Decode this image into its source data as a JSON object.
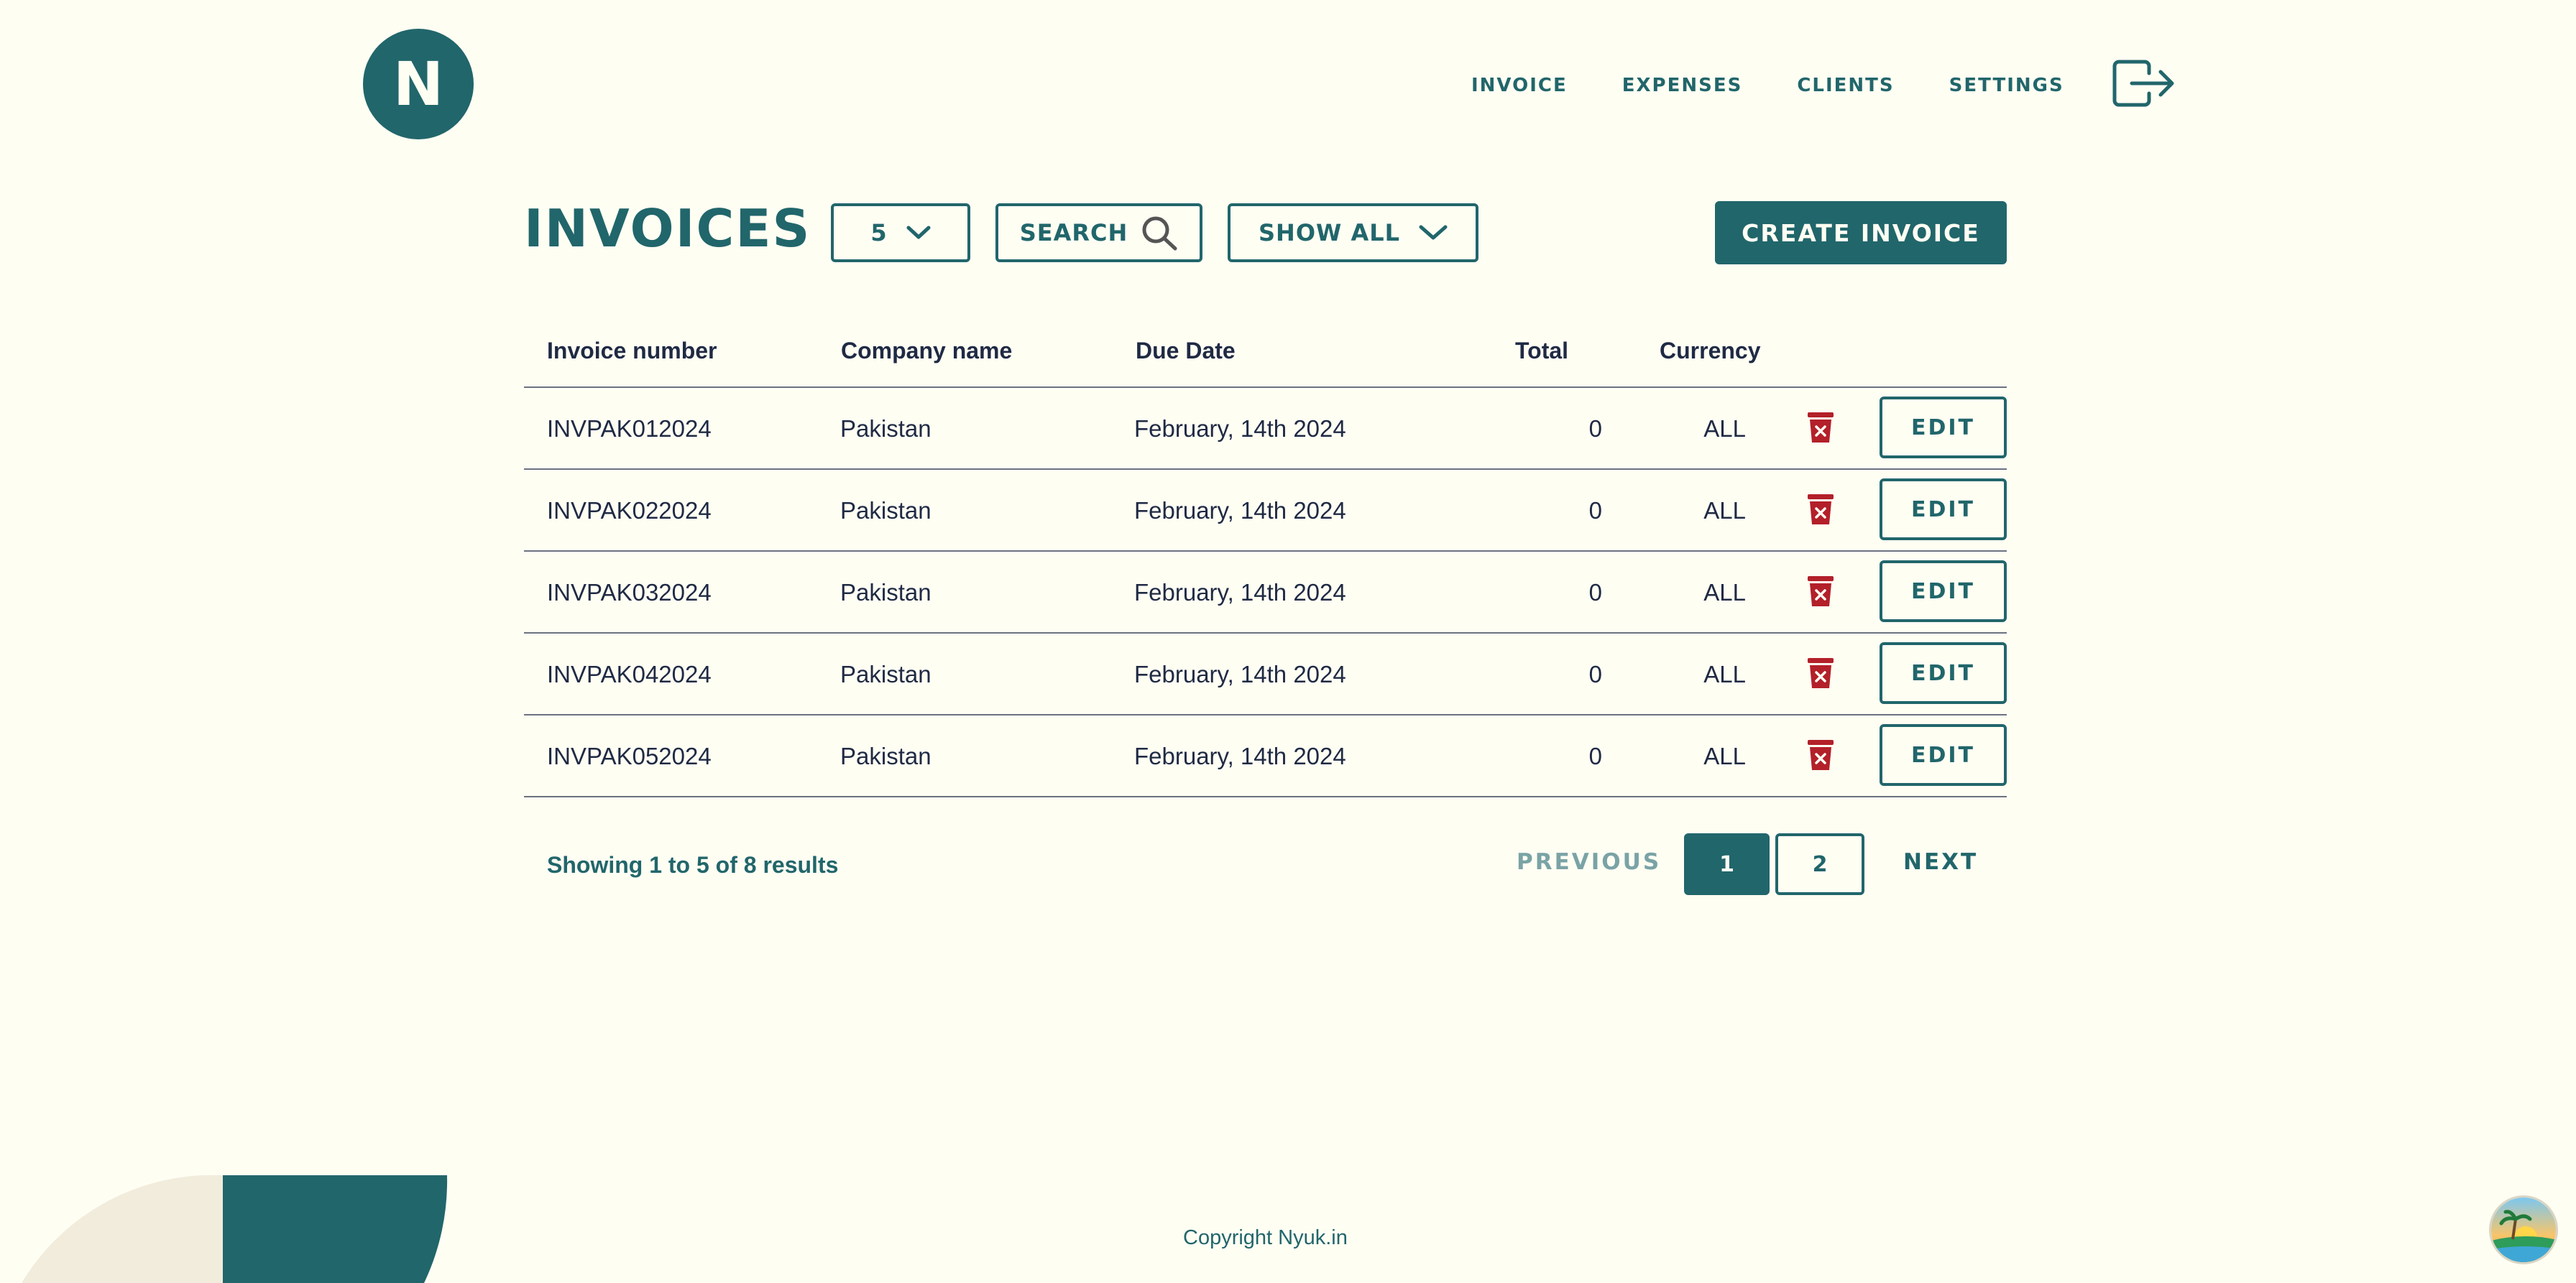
{
  "brand": {
    "logo_letter": "N"
  },
  "nav": {
    "items": [
      "INVOICE",
      "EXPENSES",
      "CLIENTS",
      "SETTINGS"
    ],
    "logout_icon": "logout-icon"
  },
  "toolbar": {
    "title": "INVOICES",
    "page_size": "5",
    "search_label": "SEARCH",
    "filter_label": "SHOW ALL",
    "create_label": "CREATE INVOICE"
  },
  "table": {
    "columns": [
      "Invoice number",
      "Company name",
      "Due Date",
      "Total",
      "Currency"
    ],
    "rows": [
      {
        "invoice_number": "INVPAK012024",
        "company": "Pakistan",
        "due_date": "February, 14th 2024",
        "total": "0",
        "currency": "ALL",
        "edit_label": "EDIT"
      },
      {
        "invoice_number": "INVPAK022024",
        "company": "Pakistan",
        "due_date": "February, 14th 2024",
        "total": "0",
        "currency": "ALL",
        "edit_label": "EDIT"
      },
      {
        "invoice_number": "INVPAK032024",
        "company": "Pakistan",
        "due_date": "February, 14th 2024",
        "total": "0",
        "currency": "ALL",
        "edit_label": "EDIT"
      },
      {
        "invoice_number": "INVPAK042024",
        "company": "Pakistan",
        "due_date": "February, 14th 2024",
        "total": "0",
        "currency": "ALL",
        "edit_label": "EDIT"
      },
      {
        "invoice_number": "INVPAK052024",
        "company": "Pakistan",
        "due_date": "February, 14th 2024",
        "total": "0",
        "currency": "ALL",
        "edit_label": "EDIT"
      }
    ]
  },
  "pagination": {
    "summary": "Showing 1 to 5 of 8 results",
    "previous": "PREVIOUS",
    "pages": [
      "1",
      "2"
    ],
    "current_page": "1",
    "next": "NEXT"
  },
  "footer": {
    "copyright": "Copyright Nyuk.in"
  },
  "colors": {
    "background": "#fffef3",
    "accent": "#21666b",
    "text": "#1f2a44",
    "danger": "#b3202a"
  }
}
